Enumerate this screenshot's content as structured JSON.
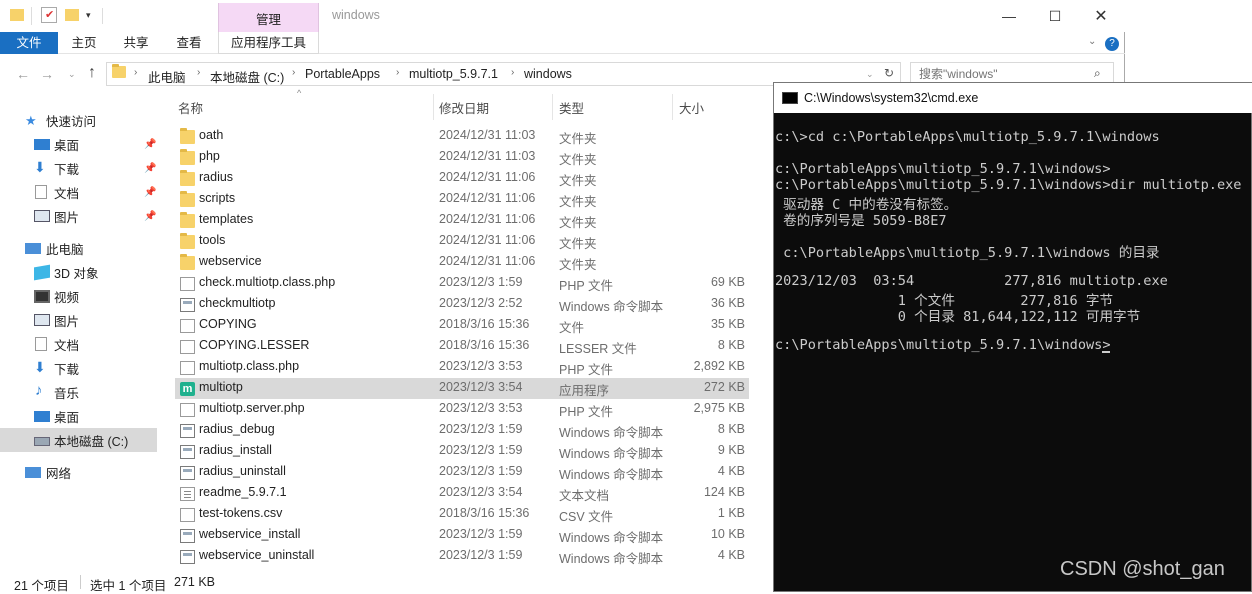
{
  "explorer": {
    "window_title": "windows",
    "manage_tab": "管理",
    "ribbon_tabs": {
      "file": "文件",
      "home": "主页",
      "share": "共享",
      "view": "查看",
      "app_tools": "应用程序工具"
    },
    "breadcrumb": [
      "此电脑",
      "本地磁盘 (C:)",
      "PortableApps",
      "multiotp_5.9.7.1",
      "windows"
    ],
    "search_placeholder": "搜索\"windows\"",
    "columns": {
      "name": "名称",
      "date": "修改日期",
      "type": "类型",
      "size": "大小"
    },
    "nav": {
      "quick_access": "快速访问",
      "desktop": "桌面",
      "downloads": "下载",
      "documents": "文档",
      "pictures": "图片",
      "this_pc": "此电脑",
      "objects3d": "3D 对象",
      "videos": "视频",
      "pictures2": "图片",
      "documents2": "文档",
      "downloads2": "下载",
      "music": "音乐",
      "desktop2": "桌面",
      "local_disk": "本地磁盘 (C:)",
      "network": "网络"
    },
    "files": [
      {
        "name": "oath",
        "date": "2024/12/31 11:03",
        "type": "文件夹",
        "size": "",
        "icon": "folder-icon"
      },
      {
        "name": "php",
        "date": "2024/12/31 11:03",
        "type": "文件夹",
        "size": "",
        "icon": "folder-icon"
      },
      {
        "name": "radius",
        "date": "2024/12/31 11:06",
        "type": "文件夹",
        "size": "",
        "icon": "folder-icon"
      },
      {
        "name": "scripts",
        "date": "2024/12/31 11:06",
        "type": "文件夹",
        "size": "",
        "icon": "folder-icon"
      },
      {
        "name": "templates",
        "date": "2024/12/31 11:06",
        "type": "文件夹",
        "size": "",
        "icon": "folder-icon"
      },
      {
        "name": "tools",
        "date": "2024/12/31 11:06",
        "type": "文件夹",
        "size": "",
        "icon": "folder-icon"
      },
      {
        "name": "webservice",
        "date": "2024/12/31 11:06",
        "type": "文件夹",
        "size": "",
        "icon": "folder-icon"
      },
      {
        "name": "check.multiotp.class.php",
        "date": "2023/12/3 1:59",
        "type": "PHP 文件",
        "size": "69 KB",
        "icon": "php-file-icon"
      },
      {
        "name": "checkmultiotp",
        "date": "2023/12/3 2:52",
        "type": "Windows 命令脚本",
        "size": "36 KB",
        "icon": "script-icon"
      },
      {
        "name": "COPYING",
        "date": "2018/3/16 15:36",
        "type": "文件",
        "size": "35 KB",
        "icon": "file-icon"
      },
      {
        "name": "COPYING.LESSER",
        "date": "2018/3/16 15:36",
        "type": "LESSER 文件",
        "size": "8 KB",
        "icon": "file-icon"
      },
      {
        "name": "multiotp.class.php",
        "date": "2023/12/3 3:53",
        "type": "PHP 文件",
        "size": "2,892 KB",
        "icon": "php-file-icon"
      },
      {
        "name": "multiotp",
        "date": "2023/12/3 3:54",
        "type": "应用程序",
        "size": "272 KB",
        "icon": "app-icon",
        "selected": true
      },
      {
        "name": "multiotp.server.php",
        "date": "2023/12/3 3:53",
        "type": "PHP 文件",
        "size": "2,975 KB",
        "icon": "php-file-icon"
      },
      {
        "name": "radius_debug",
        "date": "2023/12/3 1:59",
        "type": "Windows 命令脚本",
        "size": "8 KB",
        "icon": "script-icon"
      },
      {
        "name": "radius_install",
        "date": "2023/12/3 1:59",
        "type": "Windows 命令脚本",
        "size": "9 KB",
        "icon": "script-icon"
      },
      {
        "name": "radius_uninstall",
        "date": "2023/12/3 1:59",
        "type": "Windows 命令脚本",
        "size": "4 KB",
        "icon": "script-icon"
      },
      {
        "name": "readme_5.9.7.1",
        "date": "2023/12/3 3:54",
        "type": "文本文档",
        "size": "124 KB",
        "icon": "text-file-icon"
      },
      {
        "name": "test-tokens.csv",
        "date": "2018/3/16 15:36",
        "type": "CSV 文件",
        "size": "1 KB",
        "icon": "file-icon"
      },
      {
        "name": "webservice_install",
        "date": "2023/12/3 1:59",
        "type": "Windows 命令脚本",
        "size": "10 KB",
        "icon": "script-icon"
      },
      {
        "name": "webservice_uninstall",
        "date": "2023/12/3 1:59",
        "type": "Windows 命令脚本",
        "size": "4 KB",
        "icon": "script-icon"
      }
    ],
    "status": {
      "count": "21 个项目",
      "selected": "选中 1 个项目",
      "size": "271 KB"
    }
  },
  "cmd": {
    "title": "C:\\Windows\\system32\\cmd.exe",
    "lines": [
      "c:\\>cd c:\\PortableApps\\multiotp_5.9.7.1\\windows",
      "",
      "c:\\PortableApps\\multiotp_5.9.7.1\\windows>",
      "c:\\PortableApps\\multiotp_5.9.7.1\\windows>dir multiotp.exe",
      " 驱动器 C 中的卷没有标签。",
      " 卷的序列号是 5059-B8E7",
      "",
      " c:\\PortableApps\\multiotp_5.9.7.1\\windows 的目录",
      "",
      "2023/12/03  03:54           277,816 multiotp.exe",
      "               1 个文件        277,816 字节",
      "               0 个目录 81,644,122,112 可用字节",
      "",
      "c:\\PortableApps\\multiotp_5.9.7.1\\windows>"
    ]
  },
  "watermark": "CSDN @shot_gan",
  "colors": {
    "accent": "#1a6fc2",
    "manage_tab": "#f5d9f5",
    "selected_row": "#d9d9d9",
    "cmd_bg": "#0c0c0c"
  }
}
